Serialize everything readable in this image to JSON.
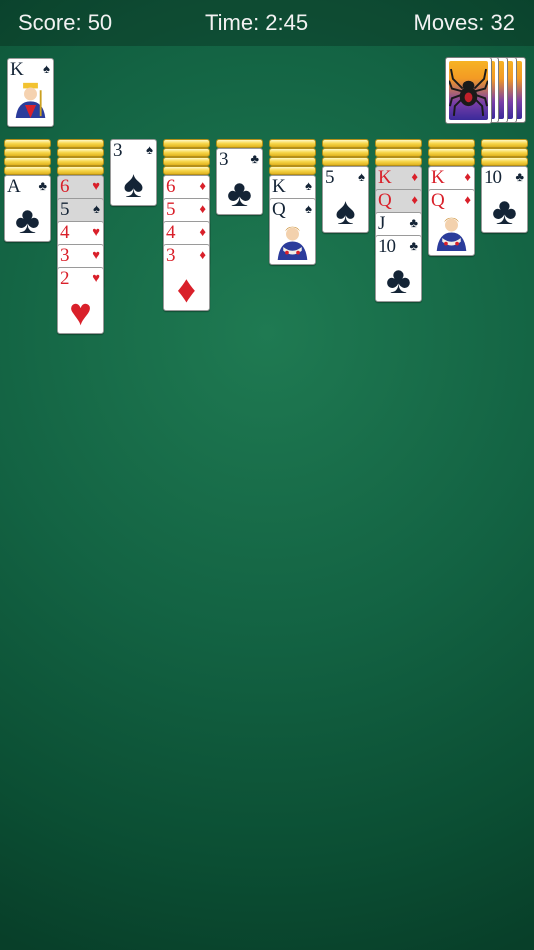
{
  "status": {
    "score_label": "Score: 50",
    "time_label": "Time: 2:45",
    "moves_label": "Moves: 32"
  },
  "foundation": {
    "top_card": {
      "rank": "K",
      "suit": "♠"
    }
  },
  "stock": {
    "icon": "spider-icon"
  },
  "columns": [
    {
      "facedown": 4,
      "cards": [
        {
          "rank": "A",
          "suit": "♣"
        }
      ]
    },
    {
      "facedown": 4,
      "cards": [
        {
          "rank": "6",
          "suit": "♥"
        },
        {
          "rank": "5",
          "suit": "♠"
        },
        {
          "rank": "4",
          "suit": "♥"
        },
        {
          "rank": "3",
          "suit": "♥"
        },
        {
          "rank": "2",
          "suit": "♥"
        }
      ]
    },
    {
      "facedown": 0,
      "cards": [
        {
          "rank": "3",
          "suit": "♠"
        }
      ]
    },
    {
      "facedown": 4,
      "cards": [
        {
          "rank": "6",
          "suit": "♦"
        },
        {
          "rank": "5",
          "suit": "♦"
        },
        {
          "rank": "4",
          "suit": "♦"
        },
        {
          "rank": "3",
          "suit": "♦"
        }
      ]
    },
    {
      "facedown": 1,
      "cards": [
        {
          "rank": "3",
          "suit": "♣"
        }
      ]
    },
    {
      "facedown": 4,
      "cards": [
        {
          "rank": "K",
          "suit": "♠"
        },
        {
          "rank": "Q",
          "suit": "♠"
        }
      ]
    },
    {
      "facedown": 3,
      "cards": [
        {
          "rank": "5",
          "suit": "♠"
        }
      ]
    },
    {
      "facedown": 3,
      "cards": [
        {
          "rank": "K",
          "suit": "♦"
        },
        {
          "rank": "Q",
          "suit": "♦"
        },
        {
          "rank": "J",
          "suit": "♣"
        },
        {
          "rank": "10",
          "suit": "♣"
        }
      ]
    },
    {
      "facedown": 3,
      "cards": [
        {
          "rank": "K",
          "suit": "♦"
        },
        {
          "rank": "Q",
          "suit": "♦"
        }
      ]
    },
    {
      "facedown": 3,
      "cards": [
        {
          "rank": "10",
          "suit": "♣"
        }
      ]
    }
  ],
  "colors": {
    "felt": "#136343",
    "red_suit": "#d9202a",
    "black_suit": "#142436",
    "card_back": "#f7d64a"
  }
}
